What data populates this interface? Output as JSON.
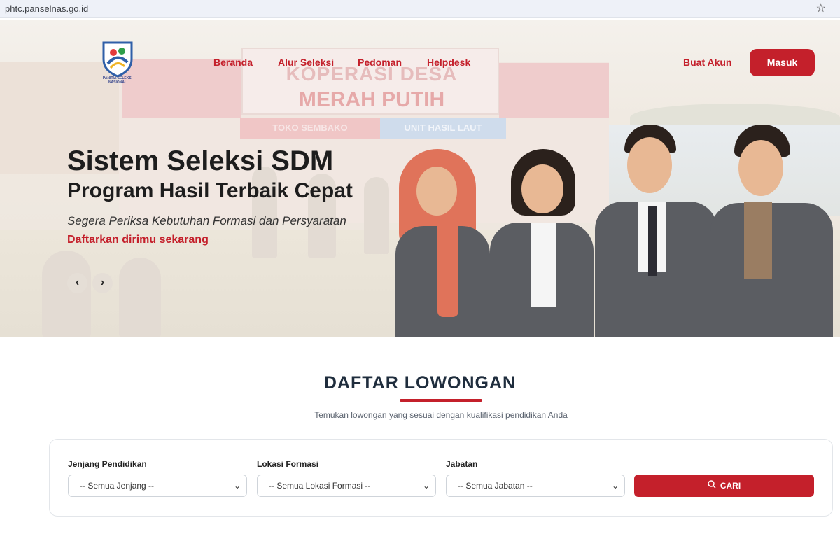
{
  "browser": {
    "url": "phtc.panselnas.go.id"
  },
  "logo": {
    "caption": "PANITIA SELEKSI NASIONAL"
  },
  "nav": {
    "items": [
      "Beranda",
      "Alur Seleksi",
      "Pedoman",
      "Helpdesk"
    ],
    "register": "Buat Akun",
    "login": "Masuk"
  },
  "hero": {
    "sign_line1": "KOPERASI DESA",
    "sign_line2": "MERAH PUTIH",
    "strip_left": "TOKO SEMBAKO",
    "strip_right": "UNIT HASIL LAUT",
    "title": "Sistem Seleksi SDM",
    "subtitle": "Program Hasil Terbaik Cepat",
    "tagline": "Segera Periksa Kebutuhan Formasi dan Persyaratan",
    "cta": "Daftarkan dirimu sekarang"
  },
  "section": {
    "title": "DAFTAR LOWONGAN",
    "description": "Temukan lowongan yang sesuai dengan kualifikasi pendidikan Anda"
  },
  "filters": {
    "education": {
      "label": "Jenjang Pendidikan",
      "value": "-- Semua Jenjang --"
    },
    "location": {
      "label": "Lokasi Formasi",
      "value": "-- Semua Lokasi Formasi --"
    },
    "position": {
      "label": "Jabatan",
      "value": "-- Semua Jabatan --"
    },
    "search_label": "CARI"
  },
  "colors": {
    "accent": "#c4202b",
    "heading": "#1f2d3d"
  },
  "icons": [
    "star-icon",
    "chevron-left-icon",
    "chevron-right-icon",
    "chevron-down-icon",
    "search-icon"
  ]
}
